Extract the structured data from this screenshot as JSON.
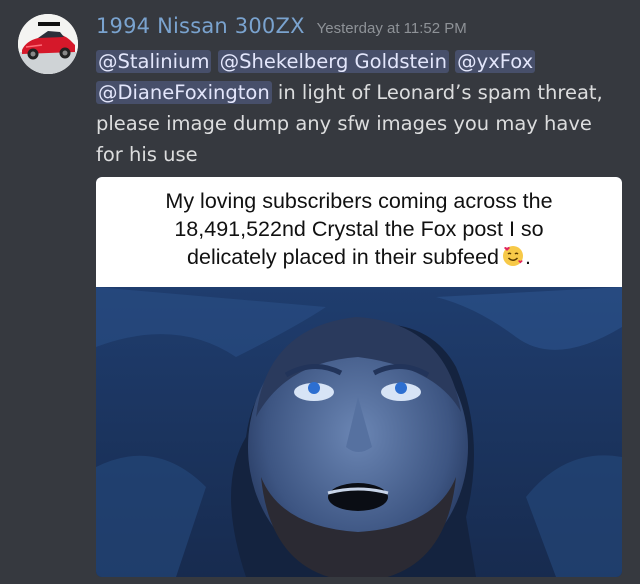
{
  "message": {
    "author": "1994 Nissan 300ZX",
    "timestamp": "Yesterday at 11:52 PM",
    "mentions": [
      "@Stalinium",
      "@Shekelberg Goldstein",
      "@yxFox",
      "@DianeFoxington"
    ],
    "text_after_mentions": " in light of Leonard’s spam threat,",
    "text_line_3": "please image dump any sfw images you may have",
    "text_line_4": "for his use"
  },
  "meme": {
    "caption_line_1": "My loving subscribers coming across the",
    "caption_line_2": "18,491,522nd Crystal the Fox post I so",
    "caption_line_3": "delicately placed in their subfeed",
    "caption_end": ".",
    "emoji": "smiling-face-with-hearts-icon"
  },
  "colors": {
    "background": "#36393f",
    "author": "#7aa3cf",
    "timestamp": "#8e9297",
    "message_text": "#dcddde",
    "mention_bg": "#3c4470"
  }
}
